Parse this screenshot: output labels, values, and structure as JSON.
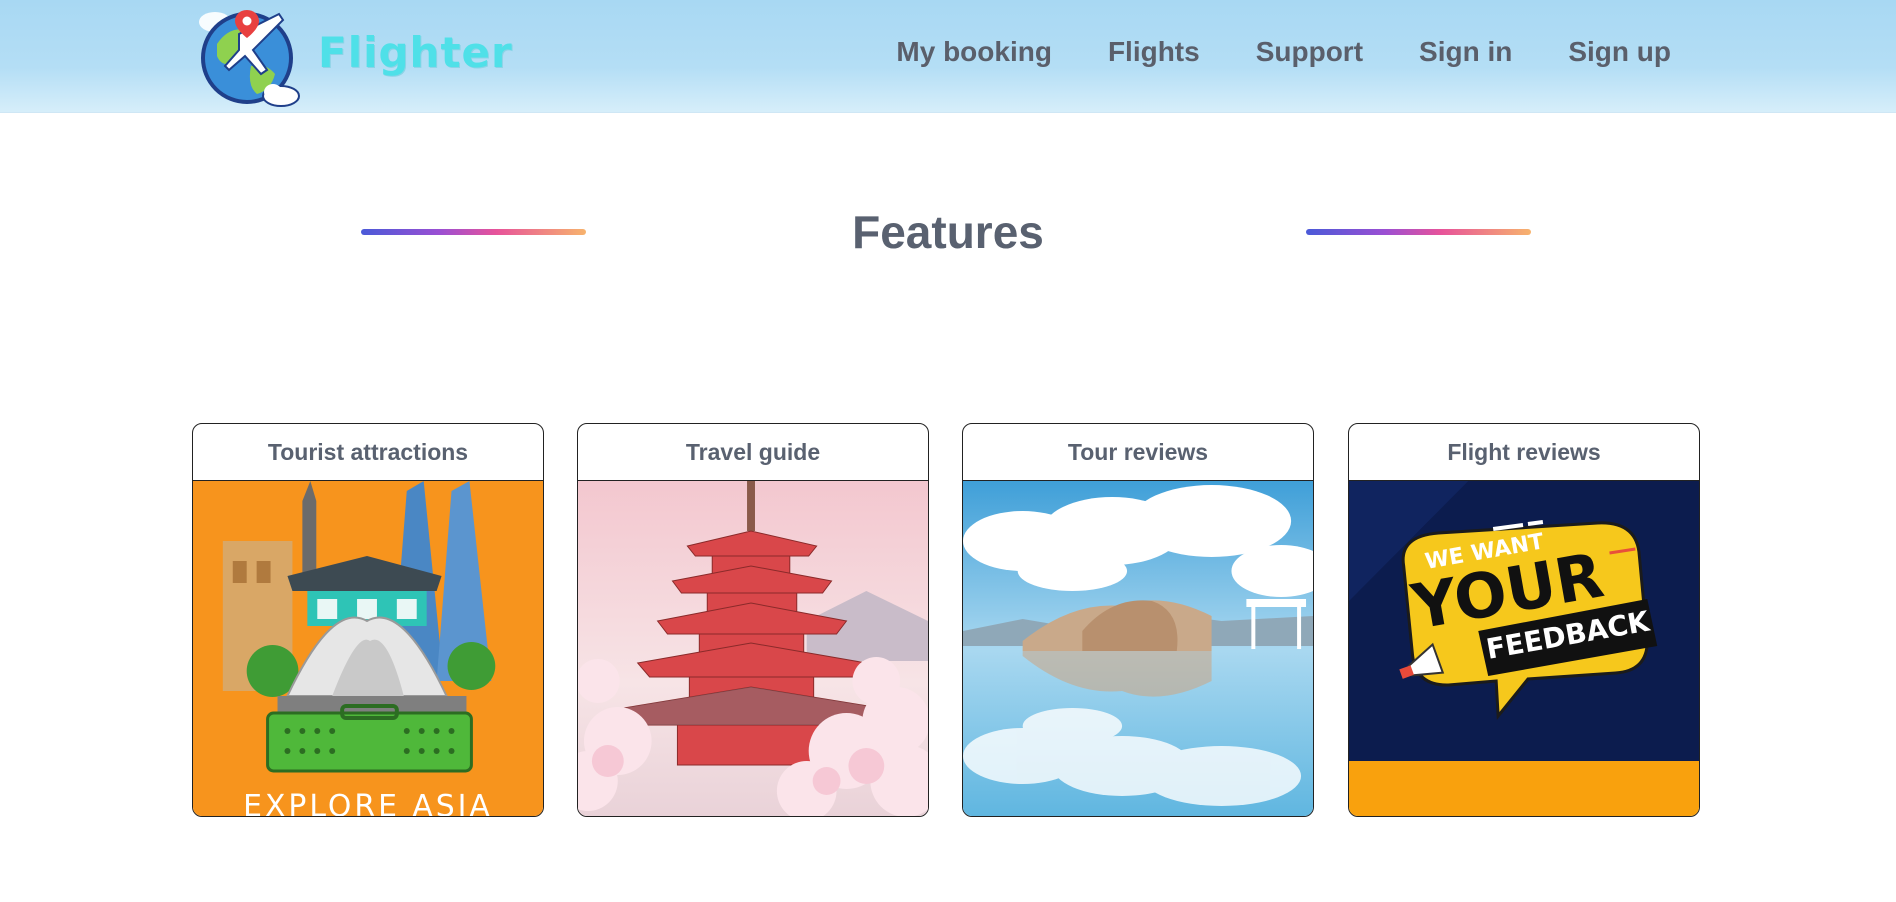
{
  "brand": {
    "name": "Flighter",
    "logo_icon": "globe-plane-logo-icon"
  },
  "nav": {
    "items": [
      {
        "label": "My booking"
      },
      {
        "label": "Flights"
      },
      {
        "label": "Support"
      },
      {
        "label": "Sign in"
      },
      {
        "label": "Sign up"
      }
    ]
  },
  "section": {
    "title": "Features",
    "accent_gradient": [
      "#4a5ad8",
      "#9b4fd3",
      "#e7539a",
      "#f7b36d"
    ]
  },
  "cards": [
    {
      "title": "Tourist attractions",
      "image_caption": "EXPLORE ASIA",
      "image_bg": "#f7941d"
    },
    {
      "title": "Travel guide",
      "image_bg": "#f4d6dc"
    },
    {
      "title": "Tour reviews",
      "image_bg": "#7fc3e6"
    },
    {
      "title": "Flight reviews",
      "image_text": [
        "WE WANT",
        "YOUR",
        "FEEDBACK"
      ],
      "image_bg": "#0c1c4e",
      "footer_color": "#f9a10d"
    }
  ],
  "colors": {
    "header": "#a8d8f3",
    "brand": "#4fe0e8",
    "nav_text": "#5a5f6b",
    "title_text": "#596170"
  }
}
